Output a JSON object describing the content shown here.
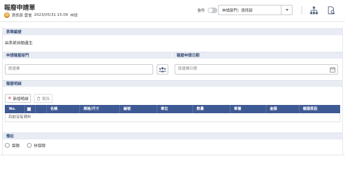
{
  "header": {
    "title": "報廢申請單",
    "applicant": "資訊部 雲雀",
    "datetime": "2023/05/31 15:09",
    "apply_label": "申請",
    "toggle_label": "會件",
    "dept_select_value": "申請部門：資訊部"
  },
  "form_number": {
    "label": "表單編號",
    "value": "由系統自動產生"
  },
  "apply_dept": {
    "label": "申請報廢部門",
    "placeholder": "請選擇"
  },
  "apply_date": {
    "label": "報廢申請日期",
    "placeholder": "請選擇日期"
  },
  "details": {
    "label": "報廢明細",
    "add_label": "新增明細",
    "delete_label": "刪除",
    "columns": [
      "No.",
      "",
      "名稱",
      "規格/尺寸",
      "編號",
      "單位",
      "數量",
      "單價",
      "金額",
      "報廢原因"
    ],
    "empty_text": "目前沒有資料"
  },
  "remarks": {
    "label": "備註",
    "options": [
      "保險",
      "非保險"
    ]
  }
}
